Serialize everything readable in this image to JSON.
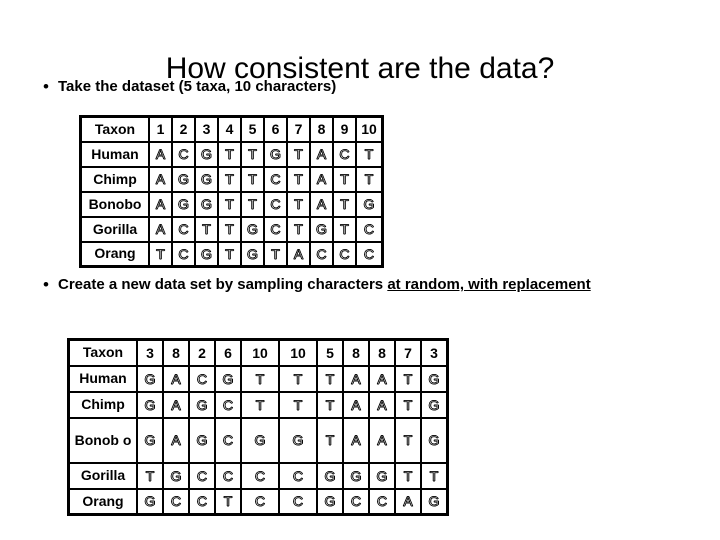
{
  "slide": {
    "title": "How consistent are the data?",
    "bullet_marker": "•"
  },
  "bullets": {
    "first": "Take the dataset (5 taxa, 10 characters)",
    "second_plain_1": "Create a new data set by sampling  characters ",
    "second_underlined": "at random, with replacement"
  },
  "table_original": {
    "corner_label": "Taxon",
    "columns": [
      "1",
      "2",
      "3",
      "4",
      "5",
      "6",
      "7",
      "8",
      "9",
      "10"
    ],
    "rows": [
      {
        "taxon": "Human",
        "bases": [
          "A",
          "C",
          "G",
          "T",
          "T",
          "G",
          "T",
          "A",
          "C",
          "T"
        ]
      },
      {
        "taxon": "Chimp",
        "bases": [
          "A",
          "G",
          "G",
          "T",
          "T",
          "C",
          "T",
          "A",
          "T",
          "T"
        ]
      },
      {
        "taxon": "Bonobo",
        "bases": [
          "A",
          "G",
          "G",
          "T",
          "T",
          "C",
          "T",
          "A",
          "T",
          "G"
        ]
      },
      {
        "taxon": "Gorilla",
        "bases": [
          "A",
          "C",
          "T",
          "T",
          "G",
          "C",
          "T",
          "G",
          "T",
          "C"
        ]
      },
      {
        "taxon": "Orang",
        "bases": [
          "T",
          "C",
          "G",
          "T",
          "G",
          "T",
          "A",
          "C",
          "C",
          "C"
        ]
      }
    ]
  },
  "table_resampled": {
    "corner_label": "Taxon",
    "columns": [
      "3",
      "8",
      "2",
      "6",
      "10",
      "10",
      "5",
      "8",
      "8",
      "7",
      "3"
    ],
    "wide_columns": [
      4,
      5
    ],
    "rows": [
      {
        "taxon": "Human",
        "bases": [
          "G",
          "A",
          "C",
          "G",
          "T",
          "T",
          "T",
          "A",
          "A",
          "T",
          "G"
        ]
      },
      {
        "taxon": "Chimp",
        "bases": [
          "G",
          "A",
          "G",
          "C",
          "T",
          "T",
          "T",
          "A",
          "A",
          "T",
          "G"
        ]
      },
      {
        "taxon": "Bonob o",
        "bases": [
          "G",
          "A",
          "G",
          "C",
          "G",
          "G",
          "T",
          "A",
          "A",
          "T",
          "G"
        ]
      },
      {
        "taxon": "Gorilla",
        "bases": [
          "T",
          "G",
          "C",
          "C",
          "C",
          "C",
          "G",
          "G",
          "G",
          "T",
          "T"
        ]
      },
      {
        "taxon": "Orang",
        "bases": [
          "G",
          "C",
          "C",
          "T",
          "C",
          "C",
          "G",
          "C",
          "C",
          "A",
          "G"
        ]
      }
    ]
  }
}
